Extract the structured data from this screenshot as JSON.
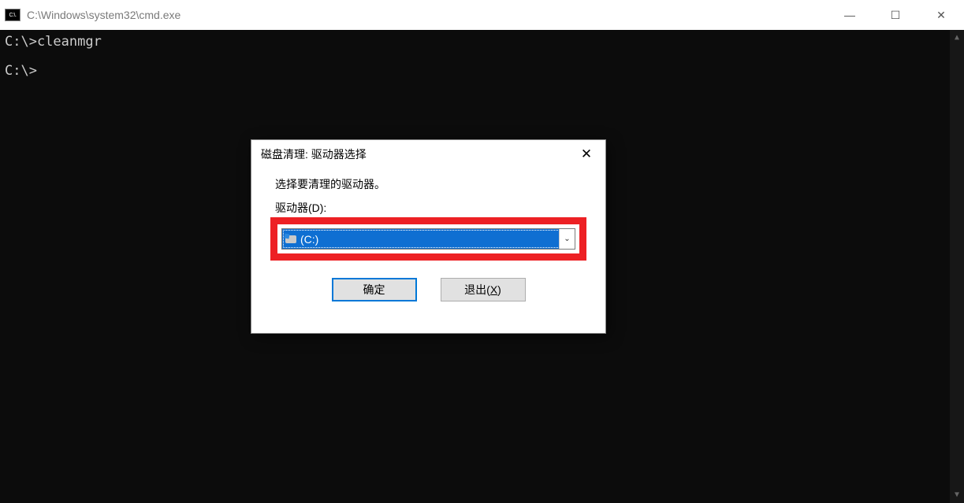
{
  "cmd": {
    "title": "C:\\Windows\\system32\\cmd.exe",
    "icon_text": "C:\\.",
    "lines": [
      "C:\\>cleanmgr",
      "C:\\>"
    ]
  },
  "dialog": {
    "title": "磁盘清理: 驱动器选择",
    "message": "选择要清理的驱动器。",
    "label": "驱动器(D):",
    "selected": " (C:)",
    "ok_label": "确定",
    "exit_prefix": "退出(",
    "exit_key": "X",
    "exit_suffix": ")"
  },
  "glyphs": {
    "minimize": "—",
    "maximize": "☐",
    "close": "✕",
    "close_dialog": "✕",
    "up": "▲",
    "down": "▼",
    "chevron": "⌄"
  }
}
